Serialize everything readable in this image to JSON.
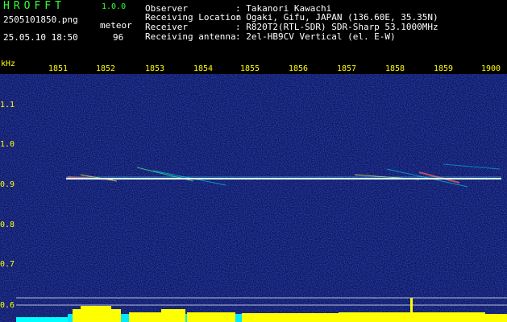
{
  "app": {
    "title": "HROFFT",
    "version": "1.0.0"
  },
  "file": {
    "name": "2505101850.png",
    "datetime": "25.05.10 18:50"
  },
  "detection": {
    "mode_label": "meteor",
    "count": "96"
  },
  "station": [
    {
      "key": "Observer",
      "value": ": Takanori Kawachi"
    },
    {
      "key": "Receiving Location",
      "value": ": Ogaki, Gifu, JAPAN (136.60E, 35.35N)"
    },
    {
      "key": "Receiver",
      "value": ": R820T2(RTL-SDR) SDR-Sharp 53.1000MHz"
    },
    {
      "key": "Receiving antenna",
      "value": ": 2el-HB9CV Vertical (el. E-W)"
    }
  ],
  "axes": {
    "y_unit": "kHz",
    "y_ticks": [
      "1.1",
      "1.0",
      "0.9",
      "0.8",
      "0.7",
      "0.6"
    ],
    "x_ticks": [
      "1851",
      "1852",
      "1853",
      "1854",
      "1855",
      "1856",
      "1857",
      "1858",
      "1859",
      "1900"
    ]
  },
  "colors": {
    "background": "#000000",
    "spectrogram_noise": "#0d1a78",
    "carrier": "#e0f0ff",
    "text_green": "#33ff33",
    "tick_yellow": "#ffff00",
    "level_yellow": "#ffff00",
    "level_cyan": "#00ffff"
  }
}
